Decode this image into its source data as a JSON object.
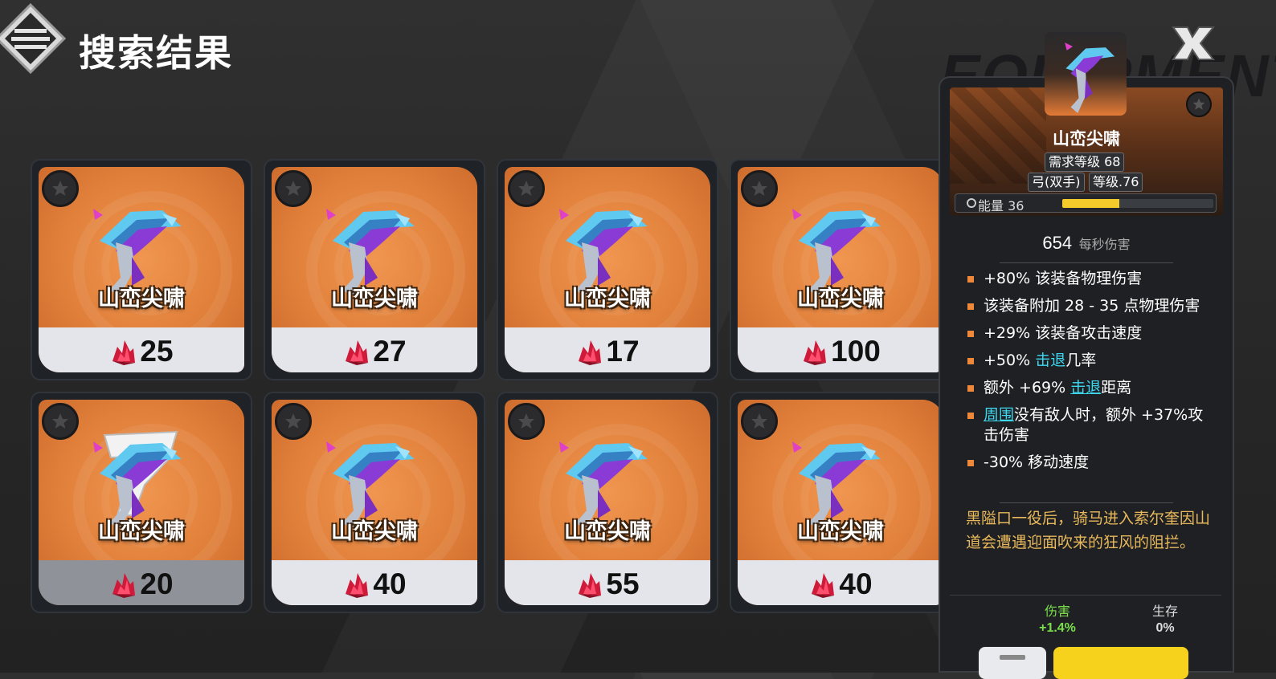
{
  "header": {
    "title": "搜索结果",
    "menu_icon": "menu-icon"
  },
  "items": [
    {
      "name": "山峦尖啸",
      "price": "25",
      "art": "bow-icon",
      "gray": false
    },
    {
      "name": "山峦尖啸",
      "price": "27",
      "art": "bow-icon",
      "gray": false
    },
    {
      "name": "山峦尖啸",
      "price": "17",
      "art": "bow-icon",
      "gray": false
    },
    {
      "name": "山峦尖啸",
      "price": "100",
      "art": "bow-icon",
      "gray": false
    },
    {
      "name": "山峦尖啸",
      "price": "20",
      "art": "bow-unknown-icon",
      "gray": true
    },
    {
      "name": "山峦尖啸",
      "price": "40",
      "art": "bow-icon",
      "gray": false
    },
    {
      "name": "山峦尖啸",
      "price": "55",
      "art": "bow-icon",
      "gray": false
    },
    {
      "name": "山峦尖啸",
      "price": "40",
      "art": "bow-icon",
      "gray": false
    }
  ],
  "detail": {
    "bg_text": "EQUIPMENT",
    "name": "山峦尖啸",
    "req_level": "需求等级 68",
    "type": "弓(双手)",
    "item_level": "等级.76",
    "energy_label": "能量 36",
    "energy_fraction": 0.38,
    "dps_value": "654",
    "dps_label": "每秒伤害",
    "stats": [
      {
        "parts": [
          {
            "t": "+80% 该装备物理伤害"
          }
        ]
      },
      {
        "parts": [
          {
            "t": "该装备附加 28 - 35 点物理伤害"
          }
        ]
      },
      {
        "parts": [
          {
            "t": "+29% 该装备攻击速度"
          }
        ]
      },
      {
        "parts": [
          {
            "t": "+50% "
          },
          {
            "t": "击退",
            "k": "link"
          },
          {
            "t": "几率"
          }
        ]
      },
      {
        "parts": [
          {
            "t": "额外 +69% "
          },
          {
            "t": "击退",
            "k": "link-u"
          },
          {
            "t": "距离"
          }
        ]
      },
      {
        "parts": [
          {
            "t": "周围",
            "k": "link-u"
          },
          {
            "t": "没有敌人时，额外 +37%攻击伤害"
          }
        ]
      },
      {
        "parts": [
          {
            "t": "-30% 移动速度"
          }
        ]
      }
    ],
    "lore": "黑隘口一役后，骑马进入索尔奎因山道会遭遇迎面吹来的狂风的阻拦。",
    "compare": [
      {
        "label": "伤害",
        "value": "+1.4%",
        "color": "#7be04a"
      },
      {
        "label": "生存",
        "value": "0%",
        "color": "#dddddd"
      }
    ]
  },
  "colors": {
    "accent_orange": "#e07f3a",
    "link_cyan": "#3ed8f0",
    "lore_gold": "#e8b85a",
    "energy_yellow": "#f3cb2b"
  }
}
